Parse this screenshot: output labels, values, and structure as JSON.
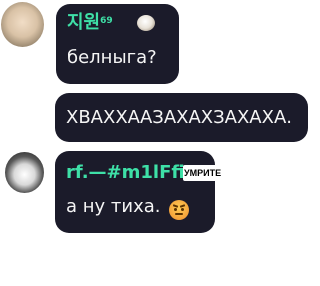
{
  "messages": [
    {
      "username": "지원",
      "username_sup": "69",
      "text": "белныга?"
    },
    {
      "text": "ХВАХХААЗАХАХЗАХАХА."
    },
    {
      "username": "rf.—#m1lFfi",
      "badge": "УМРИТЕ",
      "text": "а ну тиха."
    }
  ],
  "colors": {
    "bubble": "#1b1b2a",
    "username": "#3ee0a7",
    "text": "#f5f5f5"
  },
  "icons": [
    "avatar-photo",
    "bear-emoji",
    "angry-face-emoji"
  ]
}
